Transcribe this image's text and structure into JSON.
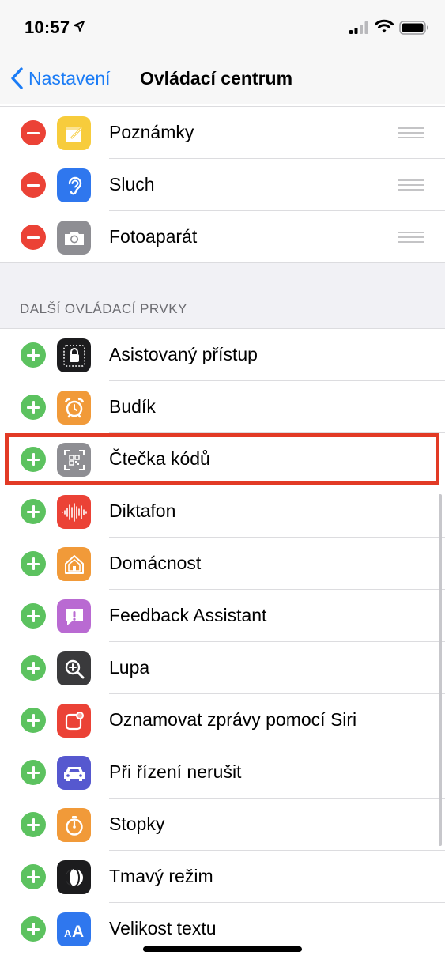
{
  "status_bar": {
    "time": "10:57"
  },
  "nav": {
    "back_label": "Nastavení",
    "title": "Ovládací centrum"
  },
  "included_controls": [
    {
      "label": "Poznámky",
      "icon": "notes-icon",
      "color": "#f7cc3c"
    },
    {
      "label": "Sluch",
      "icon": "ear-icon",
      "color": "#2f77ee"
    },
    {
      "label": "Fotoaparát",
      "icon": "camera-icon",
      "color": "#8e8e93"
    }
  ],
  "more_controls": {
    "header": "DALŠÍ OVLÁDACÍ PRVKY",
    "items": [
      {
        "label": "Asistovaný přístup",
        "icon": "lock-icon",
        "color": "#1c1c1e"
      },
      {
        "label": "Budík",
        "icon": "alarm-clock-icon",
        "color": "#f19a39"
      },
      {
        "label": "Čtečka kódů",
        "icon": "qr-code-icon",
        "color": "#8e8e93"
      },
      {
        "label": "Diktafon",
        "icon": "waveform-icon",
        "color": "#eb4236"
      },
      {
        "label": "Domácnost",
        "icon": "home-icon",
        "color": "#f19a39"
      },
      {
        "label": "Feedback Assistant",
        "icon": "feedback-icon",
        "color": "#b96ad2"
      },
      {
        "label": "Lupa",
        "icon": "magnifier-icon",
        "color": "#3a3a3c"
      },
      {
        "label": "Oznamovat zprávy pomocí Siri",
        "icon": "announce-messages-icon",
        "color": "#eb4236"
      },
      {
        "label": "Při řízení nerušit",
        "icon": "car-icon",
        "color": "#5658cf"
      },
      {
        "label": "Stopky",
        "icon": "stopwatch-icon",
        "color": "#f19a39"
      },
      {
        "label": "Tmavý režim",
        "icon": "dark-mode-icon",
        "color": "#1c1c1e"
      },
      {
        "label": "Velikost textu",
        "icon": "text-size-icon",
        "color": "#2f77ee"
      }
    ]
  },
  "highlight_color": "#e23a25"
}
